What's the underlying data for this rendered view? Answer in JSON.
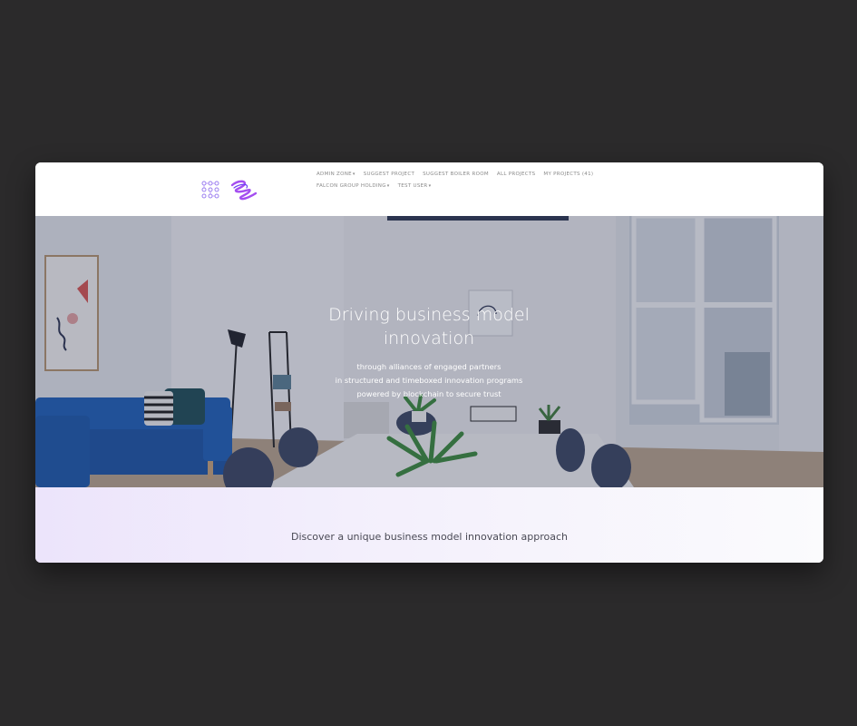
{
  "navbar": {
    "logo_icon": "dots-grid-logo",
    "brand_icon": "scribble-brand-logo",
    "brand_color": "#a44ef0",
    "row1": [
      {
        "label": "ADMIN ZONE",
        "dropdown": true
      },
      {
        "label": "SUGGEST PROJECT",
        "dropdown": false
      },
      {
        "label": "SUGGEST BOILER ROOM",
        "dropdown": false
      },
      {
        "label": "ALL PROJECTS",
        "dropdown": false
      },
      {
        "label": "MY PROJECTS (41)",
        "dropdown": false
      }
    ],
    "row2": [
      {
        "label": "FALCON GROUP HOLDING",
        "dropdown": true
      },
      {
        "label": "TEST USER",
        "dropdown": true
      }
    ]
  },
  "hero": {
    "title_line1": "Driving business model",
    "title_line2": "innovation",
    "subtitle_line1": "through alliances of engaged partners",
    "subtitle_line2": "in structured and timeboxed innovation programs",
    "subtitle_line3": "powered by blockchain to secure trust"
  },
  "discover": {
    "text": "Discover a unique business model innovation approach"
  },
  "colors": {
    "page_background": "#2b2a2b",
    "nav_text": "#8a8a8a",
    "accent_purple": "#a44ef0",
    "sofa_blue": "#1d5fb8"
  }
}
